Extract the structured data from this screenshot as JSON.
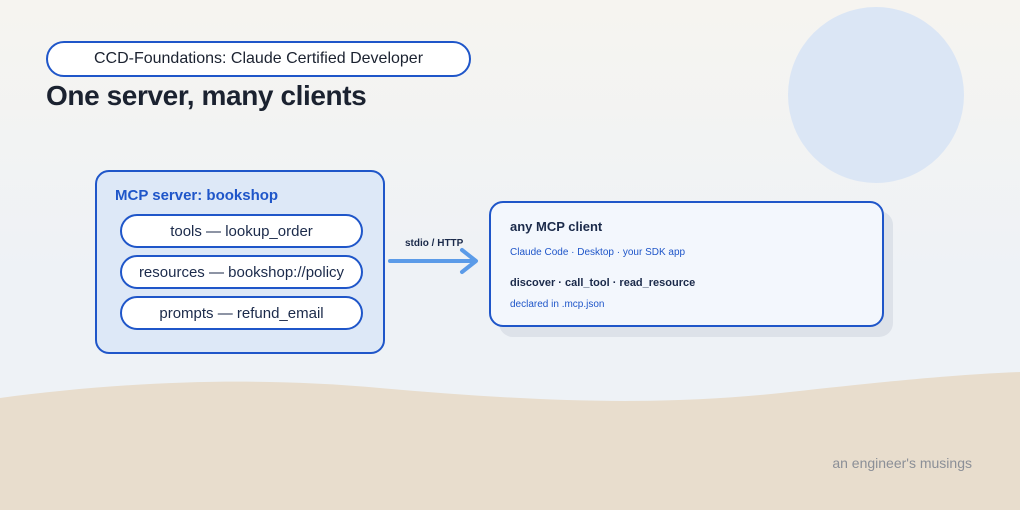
{
  "badge": "CCD-Foundations: Claude Certified Developer",
  "title": "One server, many clients",
  "server": {
    "title": "MCP server: bookshop",
    "capabilities": [
      "tools — lookup_order",
      "resources — bookshop://policy",
      "prompts — refund_email"
    ]
  },
  "transport": "stdio / HTTP",
  "client": {
    "title": "any MCP client",
    "examples": "Claude Code · Desktop · your SDK app",
    "operations": "discover · call_tool · read_resource",
    "config": "declared in .mcp.json"
  },
  "signature": "an engineer's musings",
  "colors": {
    "accent": "#1f56c9",
    "server_fill": "#dde8f7",
    "client_fill": "#f3f7fd",
    "arrow": "#5b9be8",
    "sand": "#e8ddcd",
    "circle": "#dbe6f5",
    "text_dark": "#1b2230"
  }
}
